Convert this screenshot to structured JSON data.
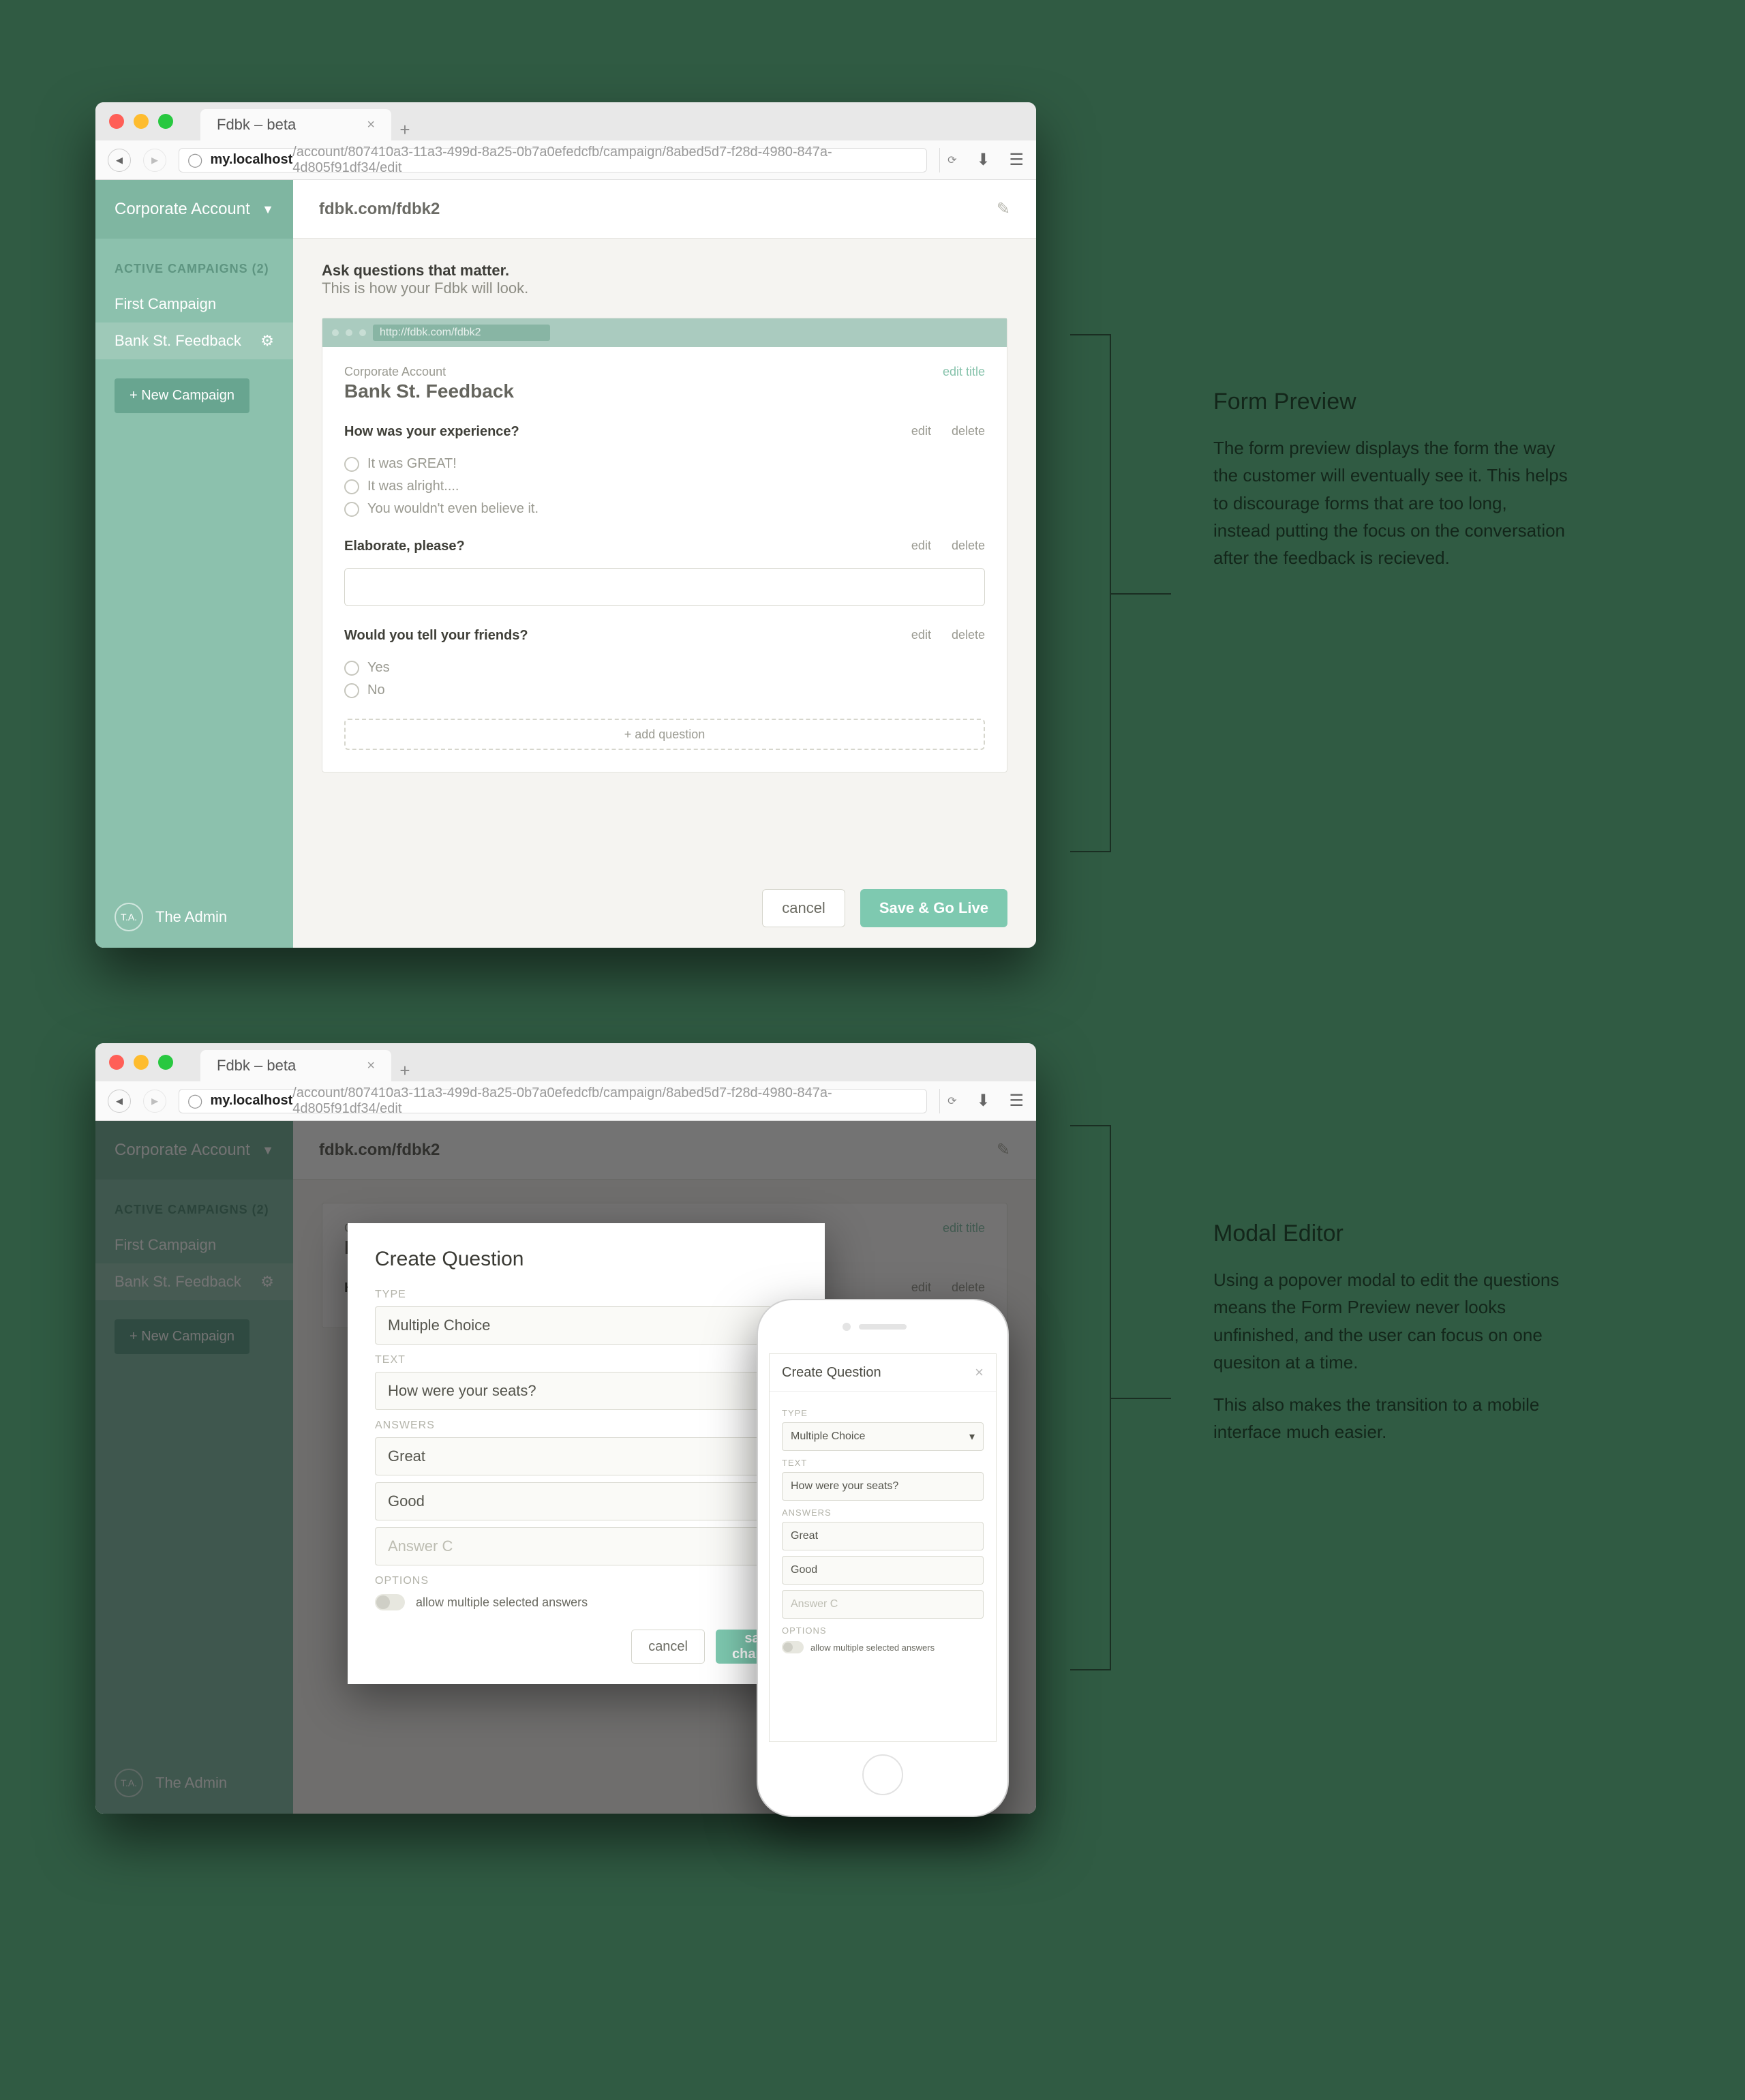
{
  "browser": {
    "tab_title": "Fdbk – beta",
    "url_host": "my.localhost",
    "url_path": "/account/807410a3-11a3-499d-8a25-0b7a0efedcfb/campaign/8abed5d7-f28d-4980-847a-4d805f91df34/edit"
  },
  "sidebar": {
    "account": "Corporate Account",
    "section_label": "ACTIVE CAMPAIGNS (2)",
    "items": [
      {
        "label": "First Campaign",
        "active": false
      },
      {
        "label": "Bank St. Feedback",
        "active": true
      }
    ],
    "new_campaign": "+ New Campaign",
    "footer_user": "The Admin",
    "avatar_initials": "T.A."
  },
  "header": {
    "url_label": "fdbk.com/fdbk2"
  },
  "lead": {
    "bold": "Ask questions that matter.",
    "sub": "This is how your Fdbk will look."
  },
  "preview": {
    "url": "http://fdbk.com/fdbk2",
    "subtitle": "Corporate Account",
    "title": "Bank St. Feedback",
    "edit_title": "edit title",
    "edit": "edit",
    "delete": "delete",
    "questions": [
      {
        "text": "How was your experience?",
        "type": "radio",
        "options": [
          "It was GREAT!",
          "It was alright....",
          "You wouldn't even believe it."
        ]
      },
      {
        "text": "Elaborate, please?",
        "type": "text"
      },
      {
        "text": "Would you tell your friends?",
        "type": "radio",
        "options": [
          "Yes",
          "No"
        ]
      }
    ],
    "add_question": "+ add question"
  },
  "actions": {
    "cancel": "cancel",
    "save": "Save & Go Live"
  },
  "modal": {
    "title": "Create Question",
    "labels": {
      "type": "TYPE",
      "text": "TEXT",
      "answers": "ANSWERS",
      "options": "OPTIONS"
    },
    "type_value": "Multiple Choice",
    "text_value": "How were your seats?",
    "answer_a": "Great",
    "answer_b": "Good",
    "answer_c_ph": "Answer C",
    "option_multi": "allow multiple selected answers",
    "cancel": "cancel",
    "save": "save changes"
  },
  "annotations": {
    "a": {
      "title": "Form Preview",
      "body": "The form preview displays the form the way the customer will eventually see it. This helps to discourage forms that are too long, instead putting the focus on the conversation after the feedback is recieved."
    },
    "b": {
      "title": "Modal Editor",
      "body1": "Using a popover modal to edit the questions means the Form Preview never looks unfinished, and the user can focus on one quesiton at a time.",
      "body2": "This also makes the transition to a mobile interface much easier."
    }
  }
}
